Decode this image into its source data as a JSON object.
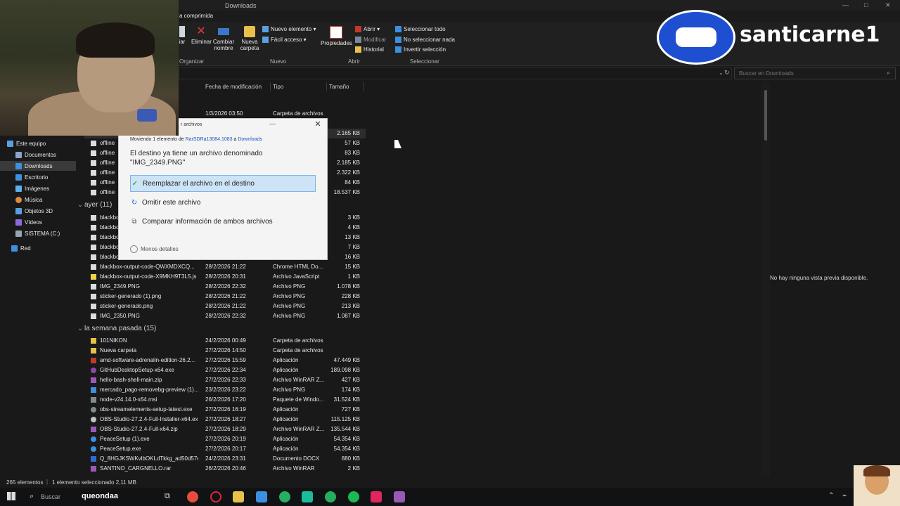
{
  "window": {
    "title": "Downloads",
    "tab_label": "a comprimida",
    "controls": {
      "minimize": "—",
      "maximize": "□",
      "close": "✕"
    }
  },
  "ribbon": {
    "organizar": {
      "eliminar": "Eliminar",
      "cambiar_nombre_1": "Cambiar",
      "cambiar_nombre_2": "nombre",
      "cut_label": "iar",
      "group": "Organizar"
    },
    "nuevo": {
      "carpeta_1": "Nueva",
      "carpeta_2": "carpeta",
      "nuevo_elemento": "Nuevo elemento ▾",
      "facil_acceso": "Fácil acceso ▾",
      "group": "Nuevo"
    },
    "abrir": {
      "propiedades": "Propiedades",
      "abrir": "Abrir ▾",
      "modificar": "Modificar",
      "historial": "Historial",
      "group": "Abrir"
    },
    "seleccionar": {
      "todo": "Seleccionar todo",
      "nada": "No seleccionar nada",
      "invertir": "Invertir selección",
      "group": "Seleccionar"
    }
  },
  "search": {
    "placeholder": "Buscar en Downloads"
  },
  "columns": {
    "fecha": "Fecha de modificación",
    "tipo": "Tipo",
    "tamano": "Tamaño"
  },
  "nav": [
    {
      "label": "Este equipo",
      "icon": "pc-icon",
      "color": "#5aa0e0"
    },
    {
      "label": "Documentos",
      "icon": "documents-icon",
      "color": "#8aa4c8"
    },
    {
      "label": "Downloads",
      "icon": "downloads-icon",
      "color": "#3d8fe0"
    },
    {
      "label": "Escritorio",
      "icon": "desktop-icon",
      "color": "#3d8fe0"
    },
    {
      "label": "Imágenes",
      "icon": "pictures-icon",
      "color": "#5ab0e8"
    },
    {
      "label": "Música",
      "icon": "music-icon",
      "color": "#e08a3d"
    },
    {
      "label": "Objetos 3D",
      "icon": "objects3d-icon",
      "color": "#5aa0e0"
    },
    {
      "label": "Vídeos",
      "icon": "videos-icon",
      "color": "#8a6ae0"
    },
    {
      "label": "SISTEMA (C:)",
      "icon": "drive-icon",
      "color": "#9aa4b0"
    },
    {
      "label": "Red",
      "icon": "network-icon",
      "color": "#3d8fe0"
    }
  ],
  "top_rows": [
    {
      "name": "",
      "date": "1/3/2026 03:50",
      "type": "Carpeta de archivos",
      "size": ""
    },
    {
      "name": "",
      "date": "",
      "type": "",
      "size": "2.165 KB"
    },
    {
      "name": "offline",
      "date": "",
      "type": "",
      "size": "57 KB"
    },
    {
      "name": "offline",
      "date": "",
      "type": "",
      "size": "83 KB"
    },
    {
      "name": "offline",
      "date": "",
      "type": "",
      "size": "2.185 KB"
    },
    {
      "name": "offline",
      "date": "",
      "type": "",
      "size": "2.322 KB"
    },
    {
      "name": "offline",
      "date": "",
      "type": "",
      "size": "84 KB"
    },
    {
      "name": "offline",
      "date": "",
      "type": "",
      "size": "18.537 KB"
    }
  ],
  "group_ayer": "ayer (11)",
  "ayer_rows": [
    {
      "name": "blackbo",
      "date": "",
      "type": "",
      "size": "3 KB"
    },
    {
      "name": "blackbo",
      "date": "",
      "type": "",
      "size": "4 KB"
    },
    {
      "name": "blackbo",
      "date": "",
      "type": "",
      "size": "13 KB"
    },
    {
      "name": "blackbo",
      "date": "",
      "type": "",
      "size": "7 KB"
    },
    {
      "name": "blackbo",
      "date": "",
      "type": "",
      "size": "16 KB"
    },
    {
      "name": "blackbox-output-code-QWXMDXCQ...",
      "date": "28/2/2026 21:22",
      "type": "Chrome HTML Do...",
      "size": "15 KB"
    },
    {
      "name": "blackbox-output-code-X9MKH9T3L5.js",
      "date": "28/2/2026 20:31",
      "type": "Archivo JavaScript",
      "size": "1 KB"
    },
    {
      "name": "IMG_2349.PNG",
      "date": "28/2/2026 22:32",
      "type": "Archivo PNG",
      "size": "1.078 KB"
    },
    {
      "name": "sticker-generado (1).png",
      "date": "28/2/2026 21:22",
      "type": "Archivo PNG",
      "size": "228 KB"
    },
    {
      "name": "sticker-generado.png",
      "date": "28/2/2026 21:22",
      "type": "Archivo PNG",
      "size": "213 KB"
    },
    {
      "name": "IMG_2350.PNG",
      "date": "28/2/2026 22:32",
      "type": "Archivo PNG",
      "size": "1.087 KB"
    }
  ],
  "group_semana": "la semana pasada (15)",
  "semana_rows": [
    {
      "name": "101NIKON",
      "date": "24/2/2026 00:49",
      "type": "Carpeta de archivos",
      "size": "",
      "icon": "folder-icon",
      "color": "#e8c14a"
    },
    {
      "name": "Nueva carpeta",
      "date": "27/2/2026 14:50",
      "type": "Carpeta de archivos",
      "size": "",
      "icon": "folder-icon",
      "color": "#e8c14a"
    },
    {
      "name": "amd-software-adrenalin-edition-26.2...",
      "date": "27/2/2026 15:59",
      "type": "Aplicación",
      "size": "47.449 KB",
      "icon": "app-icon",
      "color": "#c0392b"
    },
    {
      "name": "GitHubDesktopSetup-x64.exe",
      "date": "27/2/2026 22:34",
      "type": "Aplicación",
      "size": "189.098 KB",
      "icon": "github-icon",
      "color": "#8e44ad"
    },
    {
      "name": "hello-bash-shell-main.zip",
      "date": "27/2/2026 22:33",
      "type": "Archivo WinRAR Z...",
      "size": "427 KB",
      "icon": "winrar-icon",
      "color": "#9b59b6"
    },
    {
      "name": "mercado_pago-removebg-preview (1)...",
      "date": "23/2/2026 23:22",
      "type": "Archivo PNG",
      "size": "174 KB",
      "icon": "image-icon",
      "color": "#3d8fe0"
    },
    {
      "name": "node-v24.14.0-x64.msi",
      "date": "26/2/2026 17:20",
      "type": "Paquete de Windo...",
      "size": "31.524 KB",
      "icon": "msi-icon",
      "color": "#7f8c8d"
    },
    {
      "name": "obs-streamelements-setup-latest.exe",
      "date": "27/2/2026 16:19",
      "type": "Aplicación",
      "size": "727 KB",
      "icon": "obs-icon",
      "color": "#7f8c8d"
    },
    {
      "name": "OBS-Studio-27.2.4-Full-Installer-x64.exe",
      "date": "27/2/2026 18:27",
      "type": "Aplicación",
      "size": "115.125 KB",
      "icon": "obs-icon",
      "color": "#bdc3c7"
    },
    {
      "name": "OBS-Studio-27.2.4-Full-x64.zip",
      "date": "27/2/2026 18:29",
      "type": "Archivo WinRAR Z...",
      "size": "135.544 KB",
      "icon": "winrar-icon",
      "color": "#9b59b6"
    },
    {
      "name": "PeaceSetup (1).exe",
      "date": "27/2/2026 20:19",
      "type": "Aplicación",
      "size": "54.354 KB",
      "icon": "app-icon",
      "color": "#3d8fe0"
    },
    {
      "name": "PeaceSetup.exe",
      "date": "27/2/2026 20:17",
      "type": "Aplicación",
      "size": "54.354 KB",
      "icon": "app-icon",
      "color": "#3d8fe0"
    },
    {
      "name": "Q_8HGJKSWKvlbOKLdTkkg_ad50d57e...",
      "date": "24/2/2026 23:31",
      "type": "Documento DOCX",
      "size": "880 KB",
      "icon": "docx-icon",
      "color": "#2b6cd4"
    },
    {
      "name": "SANTINO_CARGNELLO.rar",
      "date": "26/2/2026 20:46",
      "type": "Archivo WinRAR",
      "size": "2 KB",
      "icon": "winrar-icon",
      "color": "#9b59b6"
    }
  ],
  "dialog": {
    "title": "r archivos",
    "moving_prefix": "Moviendo 1 elemento de ",
    "source": "RarSDRa13084.1083",
    "moving_mid": " a ",
    "destination": "Downloads",
    "message_1": "El destino ya tiene un archivo denominado",
    "message_2": "\"IMG_2349.PNG\"",
    "option_replace": "Reemplazar el archivo en el destino",
    "option_skip": "Omitir este archivo",
    "option_compare": "Comparar información de ambos archivos",
    "less_details": "Menos detalles"
  },
  "preview": {
    "text": "No hay ninguna vista previa disponible."
  },
  "status": {
    "count": "265 elementos",
    "selected": "1 elemento seleccionado  2,11 MB"
  },
  "taskbar": {
    "search_text": "Buscar",
    "overlay_text": "queondaa",
    "apps": [
      "explorer-icon",
      "chrome-icon",
      "opera-icon",
      "folder-icon",
      "copilot-icon",
      "chrome-icon",
      "app-icon",
      "chrome-icon",
      "spotify-icon",
      "tiktok-icon",
      "winrar-icon"
    ]
  },
  "brand": {
    "name": "santicarne1"
  }
}
